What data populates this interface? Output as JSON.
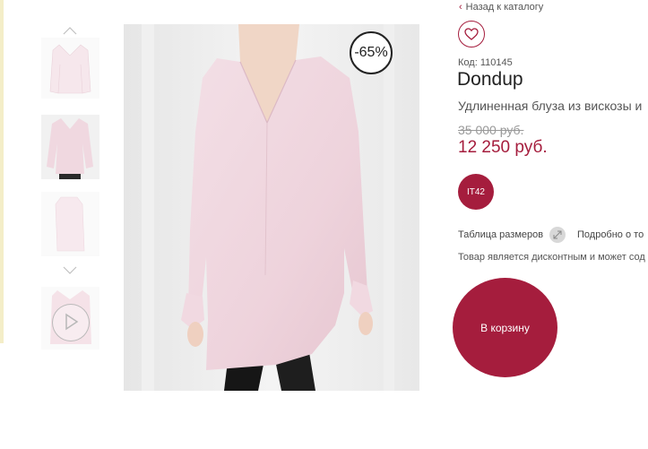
{
  "gallery": {
    "thumbnails": [
      "thumb-front",
      "thumb-model",
      "thumb-side",
      "thumb-video"
    ],
    "play_icon": "play-icon",
    "discount_badge": "-65%"
  },
  "product": {
    "back_link": "Назад к каталогу",
    "sku": "Код: 110145",
    "brand": "Dondup",
    "name": "Удлиненная блуза из вискозы и",
    "old_price": "35 000 руб.",
    "new_price": "12 250 руб.",
    "size": "IT42",
    "size_table": "Таблица размеров",
    "more": "Подробно о то",
    "discount_note": "Товар является дисконтным и может сод",
    "cart": "В корзину"
  },
  "colors": {
    "accent": "#a51d3d",
    "blouse": "#f2dde4"
  }
}
